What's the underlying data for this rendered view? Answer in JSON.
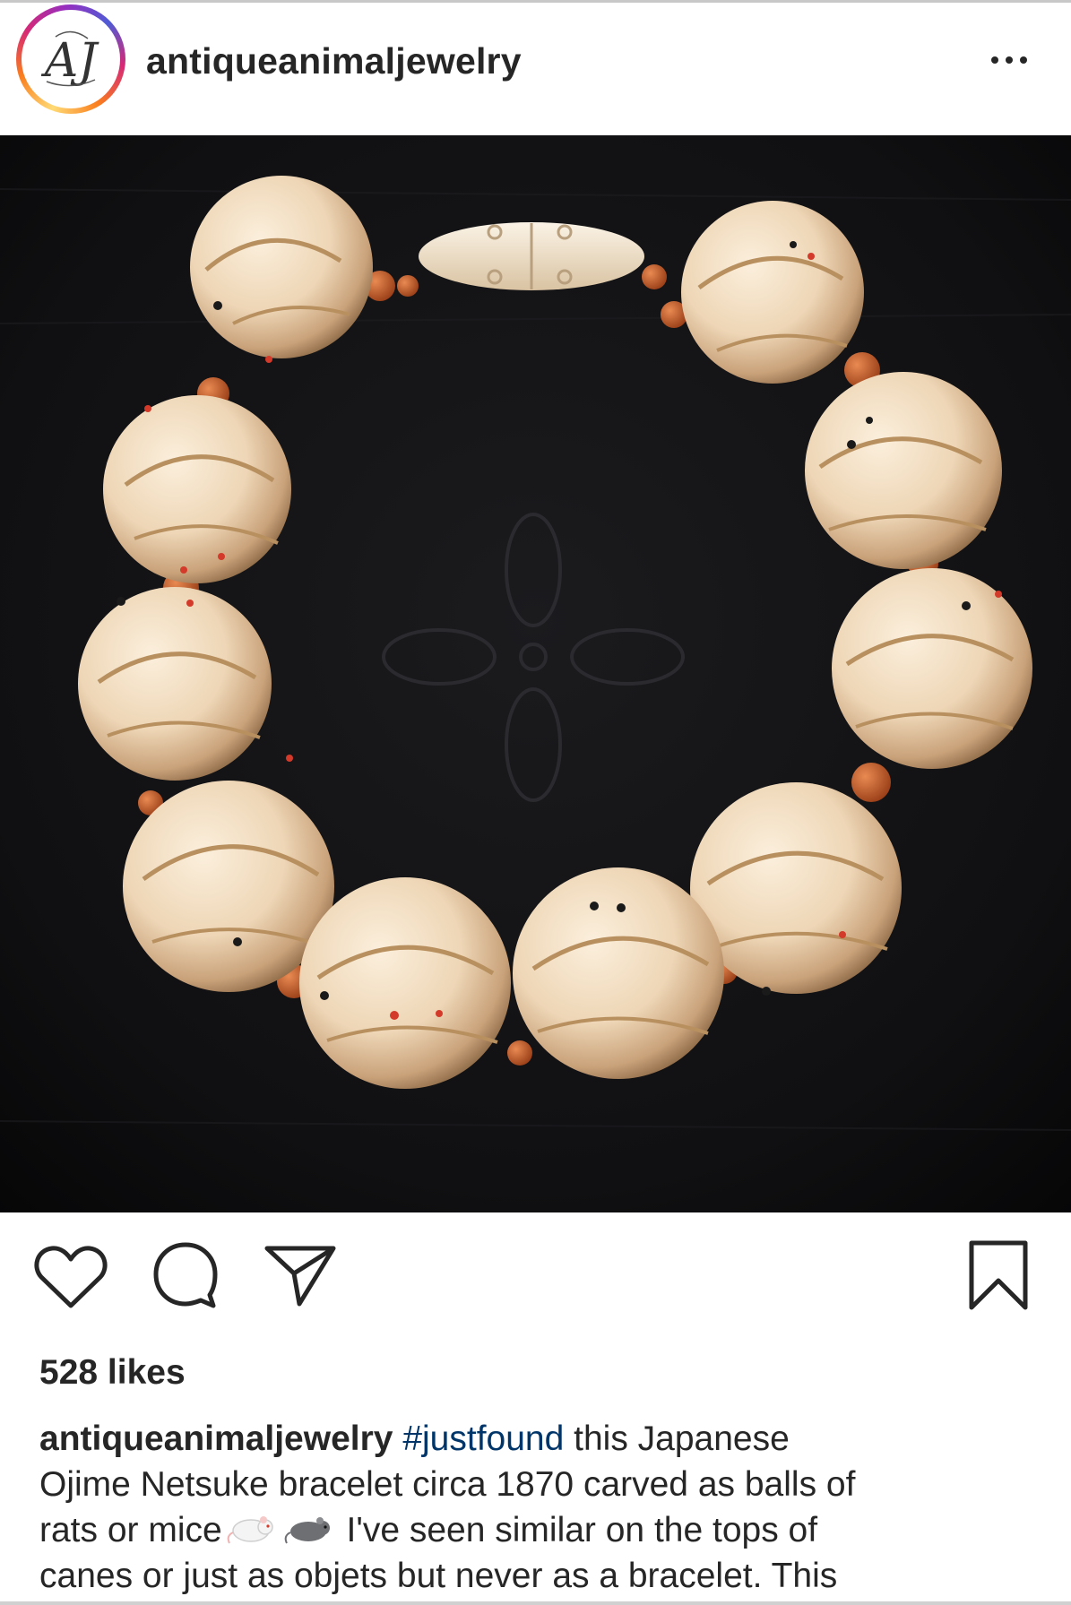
{
  "post": {
    "username": "antiqueanimaljewelry",
    "avatar_monogram": "AJ",
    "more_icon": "more-horizontal-icon",
    "photo_alt": "Japanese Ojime Netsuke bracelet of carved rat and mouse balls",
    "actions": {
      "like_icon": "heart-icon",
      "comment_icon": "comment-icon",
      "share_icon": "share-icon",
      "save_icon": "bookmark-icon"
    },
    "likes_text": "528 likes",
    "caption": {
      "username": "antiqueanimaljewelry",
      "hashtag": "#justfound",
      "line1_rest": " this Japanese",
      "line2": "Ojime Netsuke bracelet circa 1870  carved as balls of",
      "line3_start": "rats or mice",
      "emoji1": "white-rat-emoji",
      "emoji2": "rat-emoji",
      "line3_end": " I've seen similar on the tops of",
      "line4": "canes or just as objets but never as a bracelet. This"
    }
  },
  "colors": {
    "text": "#262626",
    "hashtag": "#003569",
    "photo_background": "#0e0e10",
    "bead_ivory": "#f2dcc0",
    "coral": "#c8602e"
  }
}
